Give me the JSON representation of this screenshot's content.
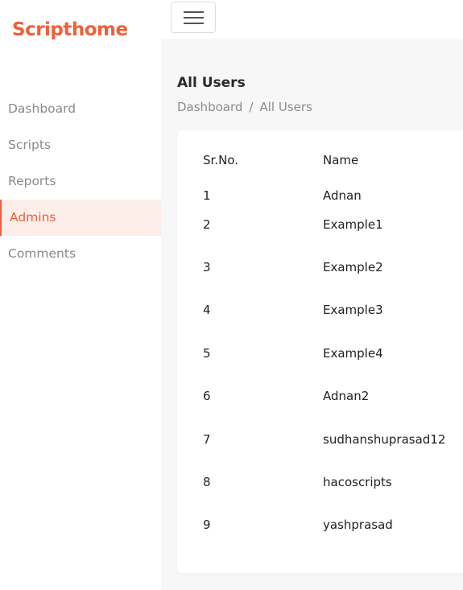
{
  "brand": {
    "name": "Scripthome",
    "color": "#f0603a"
  },
  "topbar": {
    "menu_icon": "hamburger-icon"
  },
  "sidebar": {
    "items": [
      {
        "label": "Dashboard",
        "active": false
      },
      {
        "label": "Scripts",
        "active": false
      },
      {
        "label": "Reports",
        "active": false
      },
      {
        "label": "Admins",
        "active": true
      },
      {
        "label": "Comments",
        "active": false
      }
    ]
  },
  "main": {
    "title": "All Users",
    "breadcrumb": {
      "home": "Dashboard",
      "separator": "/",
      "current": "All Users"
    },
    "table": {
      "headers": [
        "Sr.No.",
        "Name"
      ],
      "rows": [
        [
          "1",
          "Adnan"
        ],
        [
          "2",
          "Example1"
        ],
        [
          "3",
          "Example2"
        ],
        [
          "4",
          "Example3"
        ],
        [
          "5",
          "Example4"
        ],
        [
          "6",
          "Adnan2"
        ],
        [
          "7",
          "sudhanshuprasad12"
        ],
        [
          "8",
          "hacoscripts"
        ],
        [
          "9",
          "yashprasad"
        ]
      ]
    }
  }
}
